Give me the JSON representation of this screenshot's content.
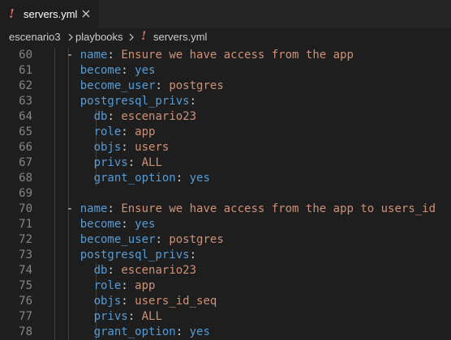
{
  "tab": {
    "icon": "!",
    "label": "servers.yml",
    "close_icon": "close-icon"
  },
  "breadcrumb": {
    "items": [
      "escenario3",
      "playbooks",
      "servers.yml"
    ],
    "file_icon": "!"
  },
  "colors": {
    "keyword_key": "#569cd6",
    "string_value": "#ce9178",
    "yaml_icon": "#e06c6c",
    "line_number": "#858585"
  },
  "lines": [
    {
      "num": "60",
      "dash": "- ",
      "key": "name",
      "value": "Ensure we have access from the app",
      "vtype": "str"
    },
    {
      "num": "61",
      "dash": "",
      "key": "become",
      "value": "yes",
      "vtype": "bool"
    },
    {
      "num": "62",
      "dash": "",
      "key": "become_user",
      "value": "postgres",
      "vtype": "str"
    },
    {
      "num": "63",
      "dash": "",
      "key": "postgresql_privs",
      "value": "",
      "vtype": "none"
    },
    {
      "num": "64",
      "dash": "",
      "key": "db",
      "value": "escenario23",
      "vtype": "str"
    },
    {
      "num": "65",
      "dash": "",
      "key": "role",
      "value": "app",
      "vtype": "str"
    },
    {
      "num": "66",
      "dash": "",
      "key": "objs",
      "value": "users",
      "vtype": "str"
    },
    {
      "num": "67",
      "dash": "",
      "key": "privs",
      "value": "ALL",
      "vtype": "str"
    },
    {
      "num": "68",
      "dash": "",
      "key": "grant_option",
      "value": "yes",
      "vtype": "bool"
    },
    {
      "num": "69",
      "dash": "",
      "key": "",
      "value": "",
      "vtype": "none"
    },
    {
      "num": "70",
      "dash": "- ",
      "key": "name",
      "value": "Ensure we have access from the app to users_id",
      "vtype": "str"
    },
    {
      "num": "71",
      "dash": "",
      "key": "become",
      "value": "yes",
      "vtype": "bool"
    },
    {
      "num": "72",
      "dash": "",
      "key": "become_user",
      "value": "postgres",
      "vtype": "str"
    },
    {
      "num": "73",
      "dash": "",
      "key": "postgresql_privs",
      "value": "",
      "vtype": "none"
    },
    {
      "num": "74",
      "dash": "",
      "key": "db",
      "value": "escenario23",
      "vtype": "str"
    },
    {
      "num": "75",
      "dash": "",
      "key": "role",
      "value": "app",
      "vtype": "str"
    },
    {
      "num": "76",
      "dash": "",
      "key": "objs",
      "value": "users_id_seq",
      "vtype": "str"
    },
    {
      "num": "77",
      "dash": "",
      "key": "privs",
      "value": "ALL",
      "vtype": "str"
    },
    {
      "num": "78",
      "dash": "",
      "key": "grant_option",
      "value": "yes",
      "vtype": "bool"
    }
  ]
}
